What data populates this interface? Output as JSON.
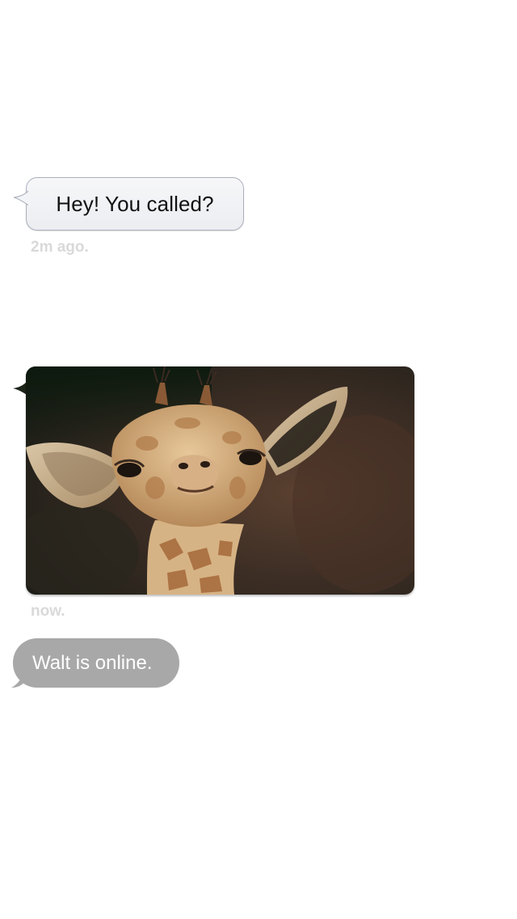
{
  "thread": {
    "messages": [
      {
        "type": "text",
        "text": "Hey! You called?",
        "timestamp": "2m ago."
      },
      {
        "type": "photo",
        "image": "baby-giraffe-photo",
        "timestamp": "now."
      }
    ],
    "status": {
      "text": "Walt is online."
    }
  },
  "colors": {
    "bubble_border": "#a9afbb",
    "bubble_fill": "#eef0f3",
    "timestamp": "#d9d9d9",
    "status_pill": "#a8a8a8",
    "status_text": "#ffffff"
  }
}
